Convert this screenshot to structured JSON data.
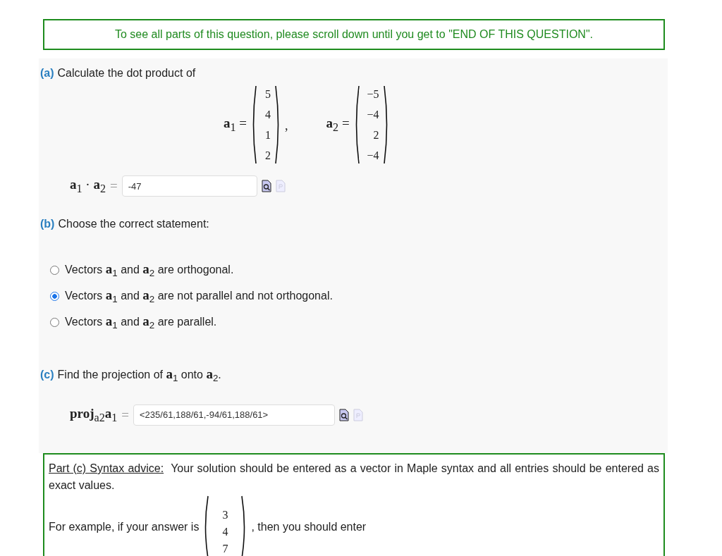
{
  "notice": "To see all parts of this question, please scroll down until you get to \"END OF THIS QUESTION\".",
  "part_a": {
    "letter": "(a)",
    "prompt": "Calculate the dot product of",
    "vectors": [
      {
        "label": "**a**$_{1}$ =",
        "entries": [
          "5",
          "4",
          "1",
          "2"
        ],
        "separator": ","
      },
      {
        "label": "**a**$_{2}$ =",
        "entries": [
          "−5",
          "−4",
          "2",
          "−4"
        ]
      }
    ],
    "answer": {
      "label": "**a**$_{1}$ · **a**$_{2}$",
      "equals": "=",
      "value": "-47"
    }
  },
  "part_b": {
    "letter": "(b)",
    "prompt": "Choose the correct statement:",
    "options": [
      {
        "text": "Vectors **a**$_{1}$ and **a**$_{2}$ are orthogonal.",
        "selected": false
      },
      {
        "text": "Vectors **a**$_{1}$ and **a**$_{2}$ are not parallel and not orthogonal.",
        "selected": true
      },
      {
        "text": "Vectors **a**$_{1}$ and **a**$_{2}$ are parallel.",
        "selected": false
      }
    ]
  },
  "part_c": {
    "letter": "(c)",
    "prompt": "Find the projection of **a**$_{1}$ onto **a**$_{2}$.",
    "answer": {
      "label": "**proj**$_{a2}$**a**$_{1}$",
      "equals": "=",
      "value": "<235/61,188/61,-94/61,188/61>"
    }
  },
  "advice": {
    "title": "Part (c) Syntax advice:",
    "text": "Your solution should be entered as a vector in Maple syntax and all entries should be entered as exact values.",
    "example_before": "For example, if your answer is",
    "example_entries": [
      "3",
      "4",
      "7"
    ],
    "example_after": ", then you should enter"
  }
}
